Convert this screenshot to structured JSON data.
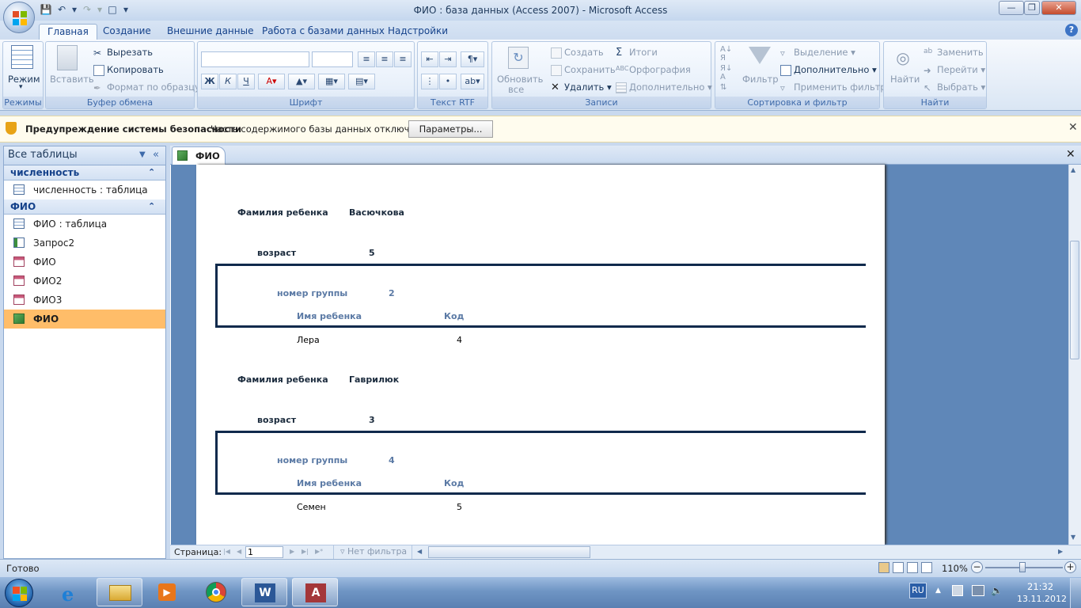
{
  "window": {
    "title": "ФИО : база данных (Access 2007) - Microsoft Access"
  },
  "ribbon": {
    "tabs": [
      {
        "label": "Главная",
        "active": true
      },
      {
        "label": "Создание"
      },
      {
        "label": "Внешние данные"
      },
      {
        "label": "Работа с базами данных"
      },
      {
        "label": "Надстройки"
      }
    ],
    "groups": {
      "views": {
        "label": "Режимы",
        "mode": "Режим"
      },
      "clipboard": {
        "label": "Буфер обмена",
        "paste": "Вставить",
        "cut": "Вырезать",
        "copy": "Копировать",
        "format_painter": "Формат по образцу"
      },
      "font": {
        "label": "Шрифт",
        "bold": "Ж",
        "italic": "К",
        "underline": "Ч"
      },
      "rtf": {
        "label": "Текст RTF"
      },
      "records": {
        "label": "Записи",
        "refresh": "Обновить",
        "refresh2": "все",
        "new": "Создать",
        "save": "Сохранить",
        "delete": "Удалить",
        "totals": "Итоги",
        "spelling": "Орфография",
        "more": "Дополнительно"
      },
      "sort": {
        "label": "Сортировка и фильтр",
        "filter": "Фильтр",
        "selection": "Выделение",
        "advanced": "Дополнительно",
        "apply": "Применить фильтр"
      },
      "find": {
        "label": "Найти",
        "find": "Найти",
        "replace": "Заменить",
        "goto": "Перейти",
        "select": "Выбрать"
      }
    }
  },
  "security_bar": {
    "title": "Предупреждение системы безопасности",
    "message": "Часть содержимого базы данных отключено",
    "options_button": "Параметры..."
  },
  "nav_pane": {
    "header": "Все таблицы",
    "groups": [
      {
        "name": "численность",
        "items": [
          {
            "label": "численность : таблица",
            "icon": "table-icon"
          }
        ]
      },
      {
        "name": "ФИО",
        "items": [
          {
            "label": "ФИО : таблица",
            "icon": "table-icon"
          },
          {
            "label": "Запрос2",
            "icon": "query-icon"
          },
          {
            "label": "ФИО",
            "icon": "form-icon"
          },
          {
            "label": "ФИО2",
            "icon": "form-icon"
          },
          {
            "label": "ФИО3",
            "icon": "form-icon"
          },
          {
            "label": "ФИО",
            "icon": "report-icon",
            "selected": true
          }
        ]
      }
    ]
  },
  "document": {
    "tab_label": "ФИО",
    "report": {
      "labels": {
        "surname": "Фамилия ребенка",
        "age": "возраст",
        "group": "номер группы",
        "child_name": "Имя ребенка",
        "code": "Код"
      },
      "records": [
        {
          "surname": "Васючкова",
          "age": "5",
          "group": "2",
          "child_name": "Лера",
          "code": "4"
        },
        {
          "surname": "Гаврилюк",
          "age": "3",
          "group": "4",
          "child_name": "Семен",
          "code": "5"
        }
      ]
    }
  },
  "record_nav": {
    "label": "Страница:",
    "page": "1",
    "filter": "Нет фильтра"
  },
  "status": {
    "text": "Готово",
    "zoom": "110%"
  },
  "taskbar": {
    "lang": "RU",
    "time": "21:32",
    "date": "13.11.2012"
  },
  "colors": {
    "selected_item": "#ffbd69",
    "report_border": "#102a4c",
    "report_canvas": "#5f87b8"
  }
}
